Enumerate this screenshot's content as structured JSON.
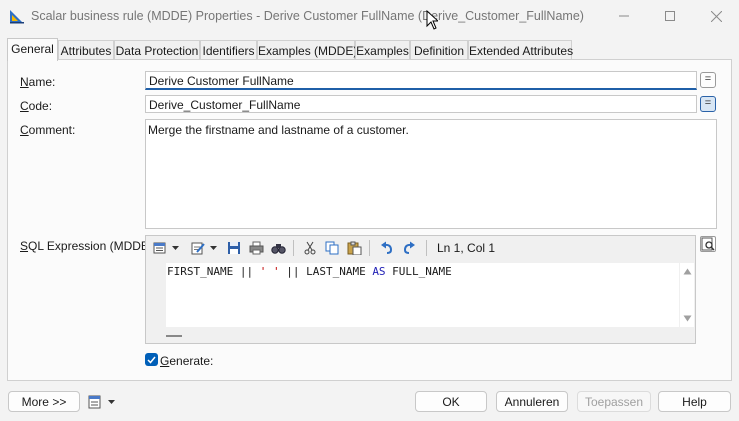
{
  "window": {
    "title": "Scalar business rule (MDDE) Properties - Derive Customer FullName (Derive_Customer_FullName)",
    "minimize_icon": "minimize-icon",
    "maximize_icon": "maximize-icon",
    "close_icon": "close-icon"
  },
  "tabs": [
    {
      "label": "General",
      "active": true
    },
    {
      "label": "Attributes"
    },
    {
      "label": "Data Protection"
    },
    {
      "label": "Identifiers"
    },
    {
      "label": "Examples (MDDE)"
    },
    {
      "label": "Examples"
    },
    {
      "label": "Definition"
    },
    {
      "label": "Extended Attributes"
    }
  ],
  "form": {
    "name_label_u": "N",
    "name_label_rest": "ame:",
    "name_value": "Derive Customer FullName",
    "code_label_u": "C",
    "code_label_rest": "ode:",
    "code_value": "Derive_Customer_FullName",
    "comment_label_u": "C",
    "comment_label_rest": "omment:",
    "comment_value": "Merge the firstname and lastname of a customer.",
    "eq_button": "=",
    "sql_label_u": "S",
    "sql_label_rest": "QL Expression (MDDE):",
    "generate_label_u": "G",
    "generate_label_rest": "enerate:",
    "generate_checked": true
  },
  "sql": {
    "position": "Ln 1, Col 1",
    "tokens": [
      {
        "text": "FIRST_NAME || ",
        "kind": "plain"
      },
      {
        "text": "' '",
        "kind": "string"
      },
      {
        "text": " || LAST_NAME ",
        "kind": "plain"
      },
      {
        "text": "AS",
        "kind": "keyword"
      },
      {
        "text": " FULL_NAME",
        "kind": "plain"
      }
    ],
    "toolbar_icons": [
      "properties-icon",
      "edit-icon",
      "save-icon",
      "print-icon",
      "find-icon",
      "cut-icon",
      "copy-icon",
      "paste-icon",
      "undo-icon",
      "redo-icon"
    ]
  },
  "buttons": {
    "more": "More >>",
    "ok": "OK",
    "cancel": "Annuleren",
    "apply": "Toepassen",
    "help": "Help"
  },
  "colors": {
    "accent": "#005fb8",
    "keyword": "#1e1eb4",
    "string": "#c00000"
  }
}
